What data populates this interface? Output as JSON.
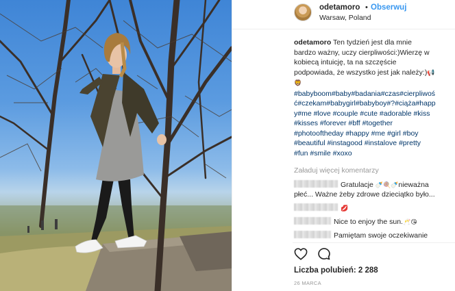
{
  "post": {
    "username": "odetamoro",
    "follow_label": "Obserwuj",
    "location": "Warsaw, Poland",
    "caption": {
      "user": "odetamoro",
      "lines": [
        "Ten tydzień jest dla mnie",
        "bardzo ważny, uczy cierpliwości:)Wierzę w",
        "kobiecą intuicję, ta na szczęście",
        "podpowiada, że wszystko jest jak należy:)"
      ],
      "hashtag_lines": [
        "#babyboom#baby#badania#czas#cierpliwoś",
        "ć#czekam#babygirl#babyboy#?#ciąża#happ",
        "y#me #love #couple #cute #adorable #kiss",
        "#kisses #forever #bff #together",
        "#photooftheday #happy #me #girl #boy",
        "#beautiful #instagood #instalove #pretty",
        "#fun #smile #xoxo"
      ]
    },
    "load_more_label": "Załaduj więcej komentarzy",
    "comments": [
      {
        "text": "Gratulacje ",
        "emoji": "🍼🍭🍼",
        "after": "nieważna"
      },
      {
        "text": "płeć... Ważne żeby zdrowe dzieciątko było..."
      },
      {
        "emoji": "💋"
      },
      {
        "text": "Nice to enjoy the sun.",
        "emoji": "🥂😘"
      },
      {
        "text": "Pamiętam swoje oczekiwanie"
      }
    ],
    "likes_text": "Liczba polubień: 2 288",
    "date_text": "26 MARCA",
    "icons": {
      "like": "heart-icon",
      "comment": "comment-icon"
    }
  }
}
